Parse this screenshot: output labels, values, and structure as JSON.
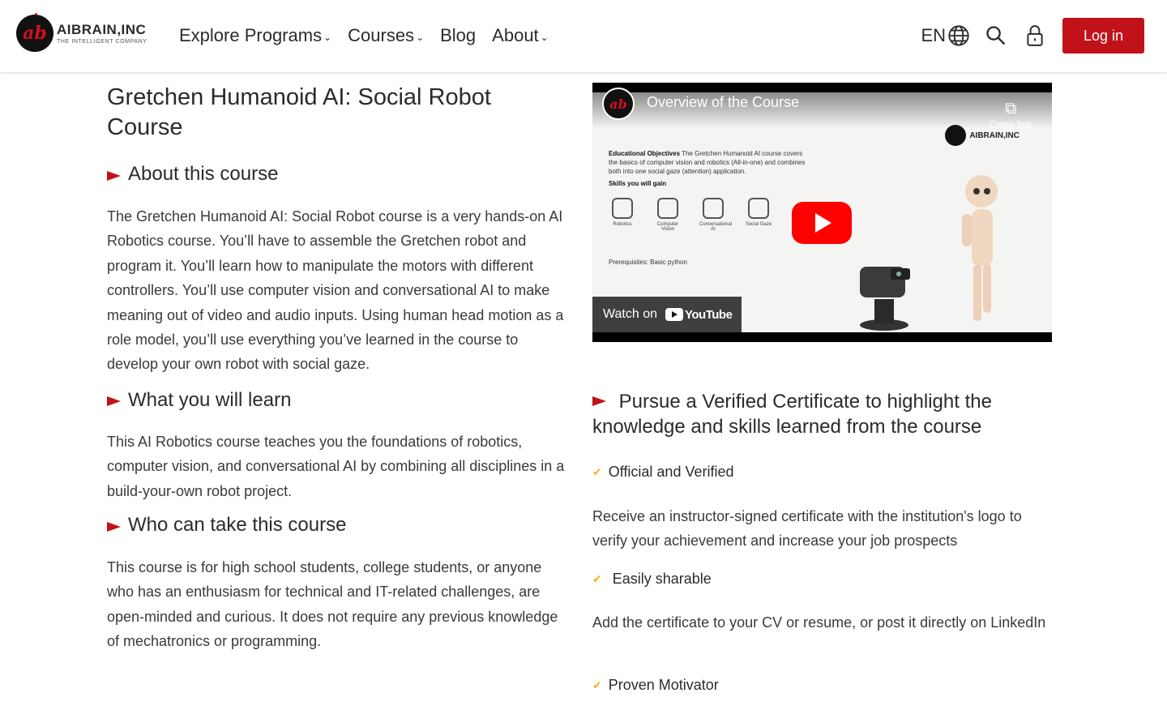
{
  "header": {
    "logo_name": "AIBRAIN,INC",
    "logo_tagline": "THE INTELLIGENT COMPANY",
    "nav": [
      {
        "label": "Explore Programs",
        "has_dropdown": true
      },
      {
        "label": "Courses",
        "has_dropdown": true
      },
      {
        "label": "Blog",
        "has_dropdown": false
      },
      {
        "label": "About",
        "has_dropdown": true
      }
    ],
    "language": "EN",
    "icons": [
      "globe-icon",
      "search-icon",
      "lock-icon"
    ],
    "login_label": "Log in",
    "accent_color": "#c1121a"
  },
  "left": {
    "title": "Gretchen Humanoid AI: Social Robot Course",
    "sections": [
      {
        "heading": "About this course",
        "body": "The Gretchen Humanoid AI: Social Robot course is a very hands-on AI Robotics course. You’ll have to assemble the Gretchen robot and program it. You’ll learn how to manipulate the motors with different controllers. You’ll use computer vision and conversational AI to make meaning out of video and audio inputs. Using human head motion as a role model, you’ll use everything you’ve learned in the course to develop your own robot with social gaze."
      },
      {
        "heading": "What you will learn",
        "body": "This AI Robotics course teaches you the foundations of robotics, computer vision, and conversational AI by combining all disciplines in a build-your-own robot project."
      },
      {
        "heading": "Who can take this course",
        "body": "This course is for high school students, college students, or anyone who has an enthusiasm for technical and IT-related challenges, are open-minded and curious. It does not require any previous knowledge of mechatronics or programming."
      }
    ]
  },
  "video": {
    "title": "Overview of the Course",
    "copy_link_label": "Copy link",
    "watch_on": "Watch on",
    "youtube_label": "YouTube",
    "slide": {
      "heading": "Educational Objectives",
      "text": "The Gretchen Humanoid AI course covers the basics of computer vision and robotics (All-in-one) and combines both into one social gaze (attention) application.",
      "skills_heading": "Skills you will gain",
      "skills": [
        "Robotics",
        "Computer Vision",
        "Conversational AI",
        "Social Gaze"
      ],
      "prereq": "Prerequisites: Basic python",
      "brand": "AIBRAIN,INC"
    }
  },
  "certificate": {
    "heading": "Pursue a Verified Certificate to highlight the knowledge and skills learned from the course",
    "items": [
      {
        "title": "Official and Verified",
        "body": "Receive an instructor-signed certificate with the institution's logo to verify your achievement and increase your job prospects"
      },
      {
        "title": "Easily sharable",
        "body": "Add the certificate to your CV or resume, or post it directly on LinkedIn"
      },
      {
        "title": "Proven Motivator",
        "body": ""
      }
    ]
  }
}
